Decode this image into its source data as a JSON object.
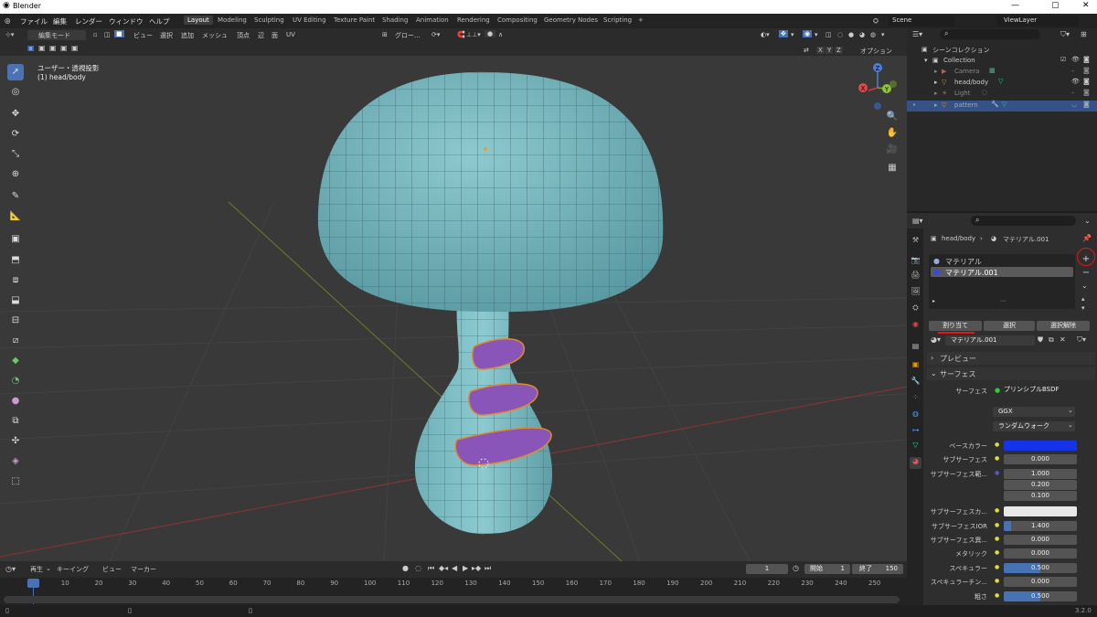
{
  "window": {
    "title": "Blender",
    "controls": [
      "—",
      "▢",
      "✕"
    ]
  },
  "menu": {
    "items": [
      "ファイル",
      "編集",
      "レンダー",
      "ウィンドウ",
      "ヘルプ"
    ]
  },
  "workspaces": [
    "Layout",
    "Modeling",
    "Sculpting",
    "UV Editing",
    "Texture Paint",
    "Shading",
    "Animation",
    "Rendering",
    "Compositing",
    "Geometry Nodes",
    "Scripting",
    "+"
  ],
  "scene": {
    "name": "Scene",
    "view_layer": "ViewLayer"
  },
  "viewport_header": {
    "mode": "編集モード",
    "menus": [
      "ビュー",
      "選択",
      "追加",
      "メッシュ",
      "頂点",
      "辺",
      "面",
      "UV"
    ],
    "transform": "グロー...",
    "axes": [
      "X",
      "Y",
      "Z"
    ],
    "options": "オプション"
  },
  "viewport": {
    "projection": "ユーザー・透視投影",
    "object": "(1) head/body"
  },
  "gizmo": {
    "x": "X",
    "y": "Y",
    "z": "Z"
  },
  "outliner": {
    "title": "シーンコレクション",
    "rows": [
      {
        "name": "Collection"
      },
      {
        "name": "Camera"
      },
      {
        "name": "head/body"
      },
      {
        "name": "Light"
      },
      {
        "name": "pattern"
      }
    ]
  },
  "properties": {
    "breadcrumb_object": "head/body",
    "breadcrumb_material": "マテリアル.001",
    "slots": [
      "マテリアル",
      "マテリアル.001"
    ],
    "assign": "割り当て",
    "select": "選択",
    "deselect": "選択解除",
    "material_name": "マテリアル.001",
    "preview": "プレビュー",
    "surface_section": "サーフェス",
    "surface_label": "サーフェス",
    "surface_value": "プリンシプルBSDF",
    "distribution": "GGX",
    "sss_method": "ランダムウォーク",
    "fields": [
      {
        "label": "ベースカラー",
        "value": ""
      },
      {
        "label": "サブサーフェス",
        "value": "0.000"
      },
      {
        "label": "サブサーフェス範...",
        "value": "1.000"
      },
      {
        "label": "",
        "value": "0.200"
      },
      {
        "label": "",
        "value": "0.100"
      },
      {
        "label": "サブサーフェスカ...",
        "value": ""
      },
      {
        "label": "サブサーフェスIOR",
        "value": "1.400"
      },
      {
        "label": "サブサーフェス異...",
        "value": "0.000"
      },
      {
        "label": "メタリック",
        "value": "0.000"
      },
      {
        "label": "スペキュラー",
        "value": "0.500"
      },
      {
        "label": "スペキュラーチン...",
        "value": "0.000"
      },
      {
        "label": "粗さ",
        "value": "0.500"
      }
    ],
    "colors": {
      "base": "#1533e8",
      "sss": "#e8e8e8"
    }
  },
  "timeline": {
    "menus": [
      "再生",
      "キーイング",
      "ビュー",
      "マーカー"
    ],
    "current_frame": "1",
    "start_label": "開始",
    "start": "1",
    "end_label": "終了",
    "end": "150",
    "ticks": [
      "1",
      "10",
      "20",
      "30",
      "40",
      "50",
      "60",
      "70",
      "80",
      "90",
      "100",
      "110",
      "120",
      "130",
      "140",
      "150",
      "160",
      "170",
      "180",
      "190",
      "200",
      "210",
      "220",
      "230",
      "240",
      "250"
    ]
  },
  "status": {
    "version": "3.2.0"
  }
}
